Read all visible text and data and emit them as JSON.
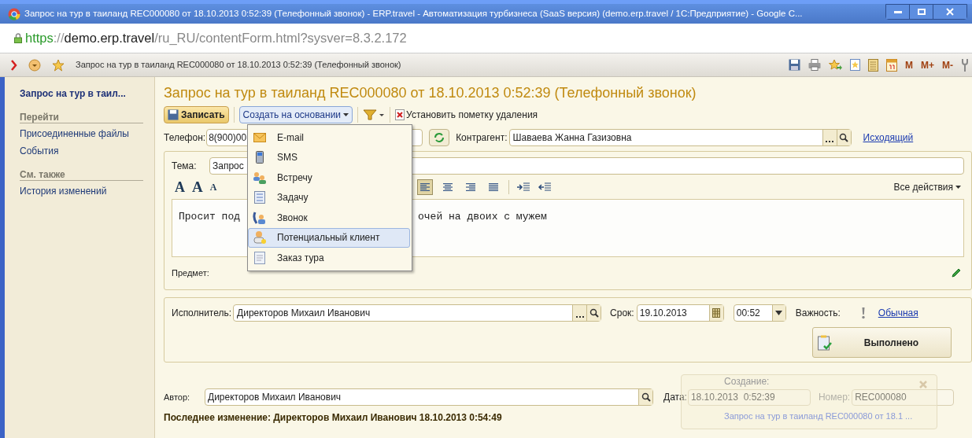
{
  "browser": {
    "title": "Запрос на тур в таиланд REC000080 от 18.10.2013 0:52:39 (Телефонный звонок) - ERP.travel - Автоматизация турбизнеса (SaaS версия) (demo.erp.travel / 1С:Предприятие) - Google C...",
    "url": {
      "scheme": "https",
      "separator": "://",
      "host": "demo.erp.travel",
      "path": "/ru_RU/contentForm.html?sysver=8.3.2.172"
    }
  },
  "app_toolbar": {
    "tab_title": "Запрос на тур в таиланд REC000080 от 18.10.2013 0:52:39 (Телефонный звонок)",
    "memory_buttons": [
      "M",
      "M+",
      "M-"
    ]
  },
  "sidebar": {
    "title": "Запрос на тур в таил...",
    "sections": [
      {
        "heading": "Перейти",
        "items": [
          "Присоединенные файлы",
          "События"
        ]
      },
      {
        "heading": "См. также",
        "items": [
          "История изменений"
        ]
      }
    ]
  },
  "form": {
    "title": "Запрос на тур в таиланд REC000080 от 18.10.2013 0:52:39 (Телефонный звонок)",
    "toolbar": {
      "save": "Записать",
      "create_based_on": "Создать на основании",
      "mark_deletion": "Установить пометку удаления"
    },
    "create_menu": [
      {
        "label": "E-mail",
        "kind": "email",
        "selected": false
      },
      {
        "label": "SMS",
        "kind": "sms",
        "selected": false
      },
      {
        "label": "Встречу",
        "kind": "meeting",
        "selected": false
      },
      {
        "label": "Задачу",
        "kind": "task",
        "selected": false
      },
      {
        "label": "Звонок",
        "kind": "call",
        "selected": false
      },
      {
        "label": "Потенциальный клиент",
        "kind": "client",
        "selected": true
      },
      {
        "label": "Заказ тура",
        "kind": "order",
        "selected": false
      }
    ],
    "phone": {
      "label": "Телефон:",
      "value": "8(900)00"
    },
    "counterparty": {
      "label": "Контрагент:",
      "value": "Шаваева Жанна Газизовна"
    },
    "direction_link": "Исходящий",
    "subject": {
      "label": "Тема:",
      "value": "Запрос"
    },
    "font_buttons": [
      "A",
      "A",
      "A"
    ],
    "align_buttons": [
      {
        "kind": "left",
        "selected": true
      },
      {
        "kind": "center",
        "selected": false
      },
      {
        "kind": "right",
        "selected": false
      },
      {
        "kind": "justify",
        "selected": false
      }
    ],
    "all_actions": "Все действия",
    "body_text": [
      "Просит под",
      "очей на двоих с мужем"
    ],
    "item_label": "Предмет:",
    "executor": {
      "label": "Исполнитель:",
      "value": "Директоров Михаил Иванович"
    },
    "deadline": {
      "label": "Срок:",
      "date": "19.10.2013",
      "time": "00:52"
    },
    "importance": {
      "label": "Важность:",
      "value": "Обычная"
    },
    "done_button": "Выполнено",
    "author": {
      "label": "Автор:",
      "value": "Директоров Михаил Иванович"
    },
    "date": {
      "label": "Дата:",
      "value": "18.10.2013  0:52:39"
    },
    "number": {
      "label": "Номер:",
      "value": "REC000080"
    },
    "last_change": "Последнее изменение: Директоров Михаил Иванович 18.10.2013 0:54:49",
    "notification": {
      "title": "Создание:",
      "link": "Запрос на тур в таиланд REC000080 от 18.1 ..."
    }
  }
}
